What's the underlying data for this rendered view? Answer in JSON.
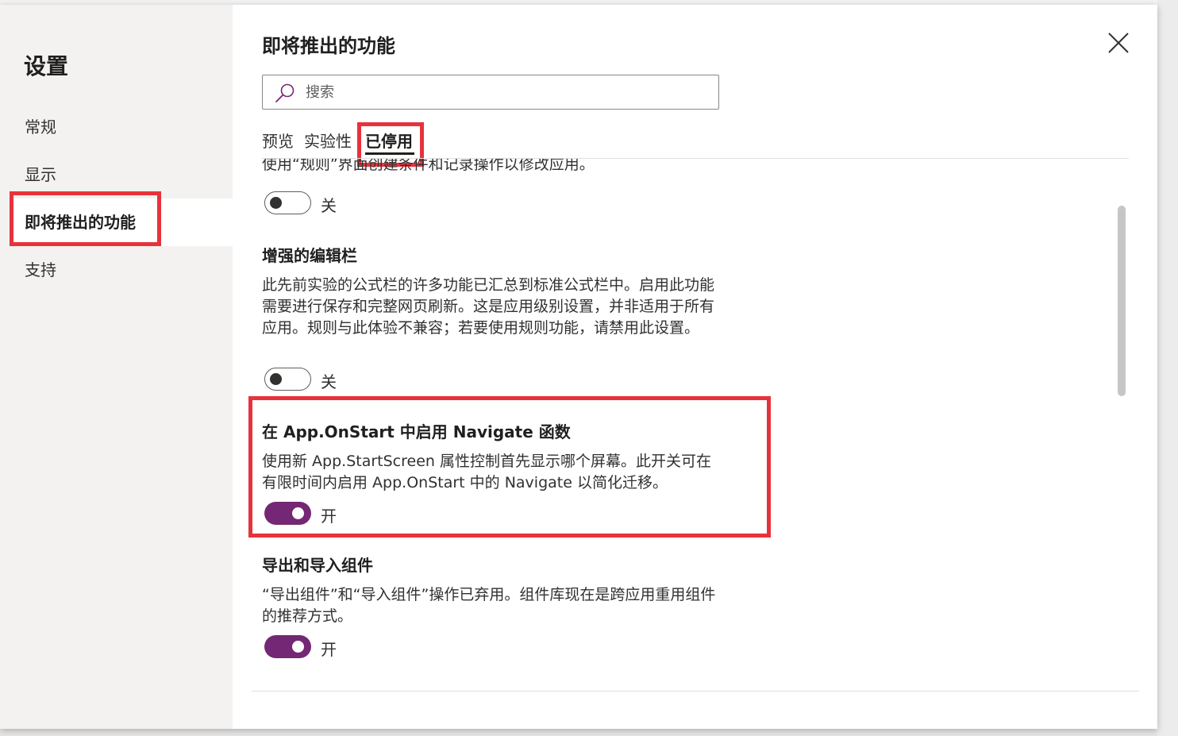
{
  "sidebar": {
    "title": "设置",
    "items": [
      {
        "label": "常规"
      },
      {
        "label": "显示"
      },
      {
        "label": "即将推出的功能"
      },
      {
        "label": "支持"
      }
    ]
  },
  "header": {
    "title": "即将推出的功能"
  },
  "search": {
    "placeholder": "搜索"
  },
  "tabs": [
    {
      "label": "预览"
    },
    {
      "label": "实验性"
    },
    {
      "label": "已停用"
    }
  ],
  "features": [
    {
      "title": "",
      "description": "使用“规则”界面创建条件和记录操作以修改应用。",
      "toggle_state": "off",
      "toggle_label": "关"
    },
    {
      "title": "增强的编辑栏",
      "description": "此先前实验的公式栏的许多功能已汇总到标准公式栏中。启用此功能需要进行保存和完整网页刷新。这是应用级别设置，并非适用于所有应用。规则与此体验不兼容；若要使用规则功能，请禁用此设置。",
      "toggle_state": "off",
      "toggle_label": "关"
    },
    {
      "title": "在 App.OnStart 中启用 Navigate 函数",
      "description": "使用新 App.StartScreen 属性控制首先显示哪个屏幕。此开关可在有限时间内启用 App.OnStart 中的 Navigate 以简化迁移。",
      "toggle_state": "on",
      "toggle_label": "开"
    },
    {
      "title": "导出和导入组件",
      "description": "“导出组件”和“导入组件”操作已弃用。组件库现在是跨应用重用组件的推荐方式。",
      "toggle_state": "on",
      "toggle_label": "开"
    }
  ],
  "colors": {
    "accent": "#742774",
    "highlight": "#e8323b",
    "sidebar_bg": "#f3f2f1"
  },
  "icons": {
    "search": "search-icon",
    "close": "close-icon"
  }
}
